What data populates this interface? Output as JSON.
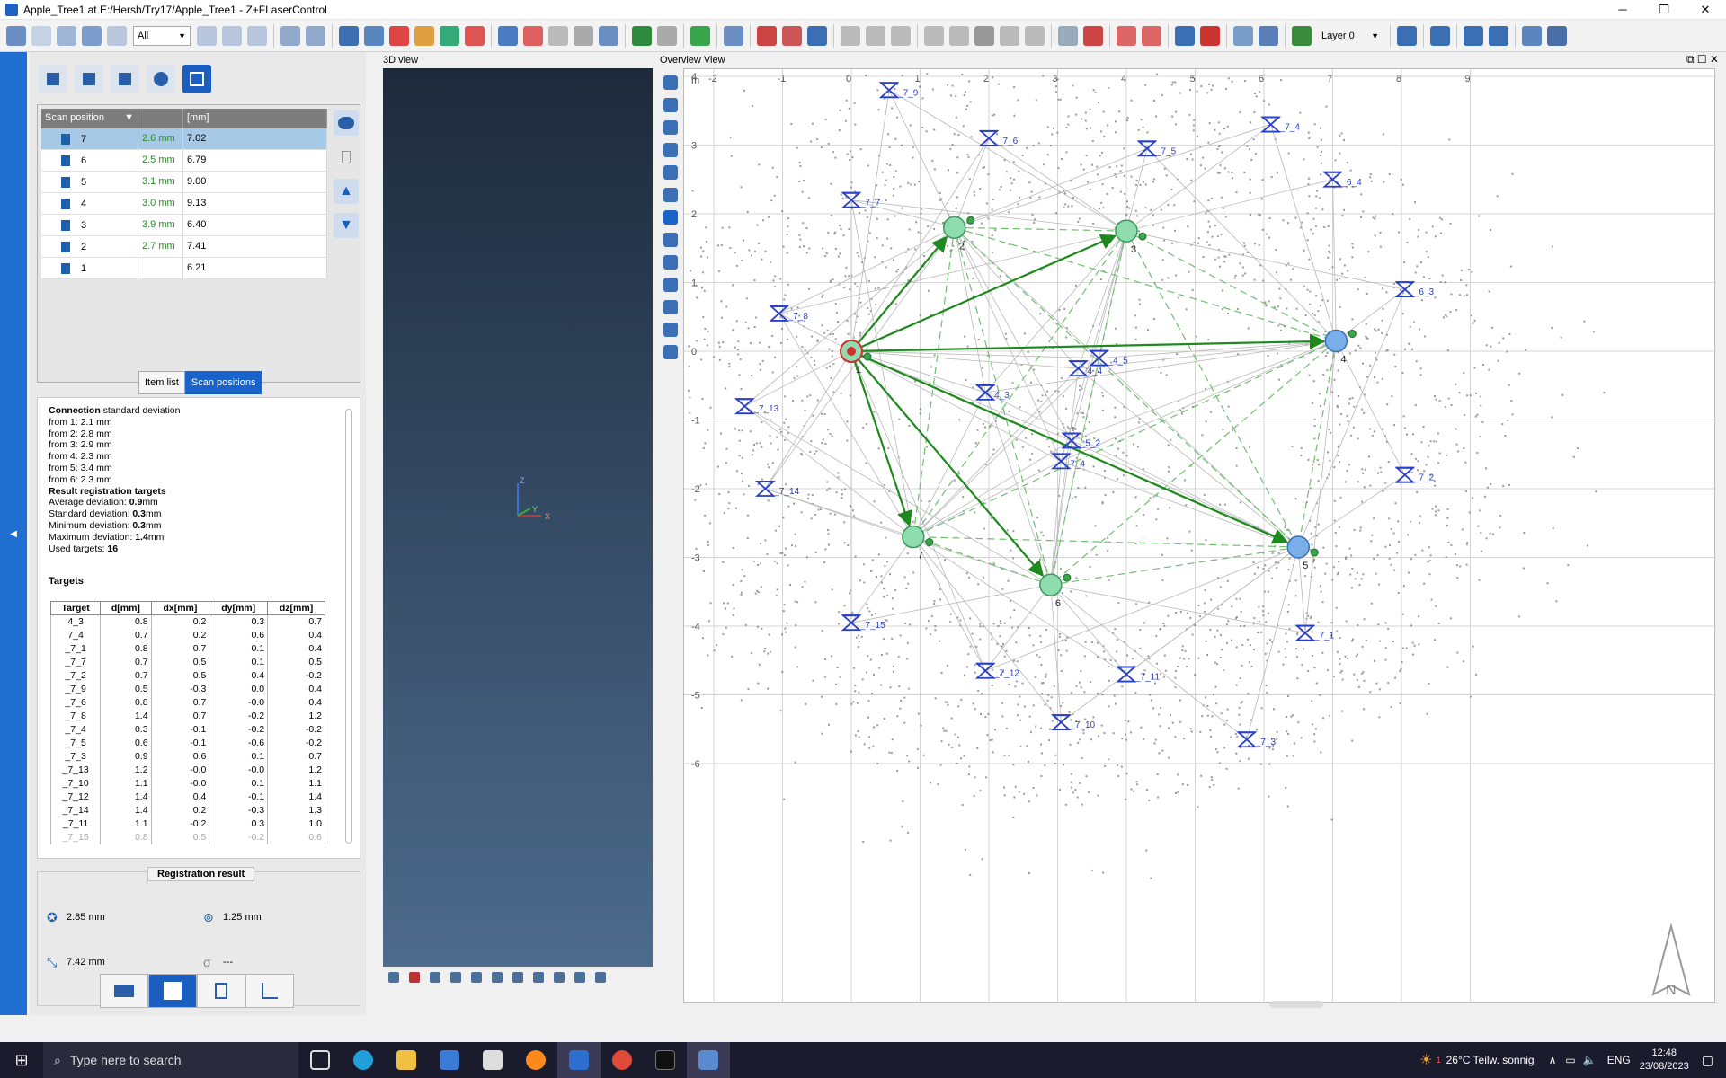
{
  "window": {
    "title": "Apple_Tree1 at E:/Hersh/Try17/Apple_Tree1 - Z+FLaserControl",
    "min": "─",
    "max": "❐",
    "close": "✕"
  },
  "toolbar": {
    "filter_value": "All",
    "layer_value": "Layer 0"
  },
  "scan_table": {
    "headers": [
      "Scan position",
      "",
      "[mm]"
    ],
    "rows": [
      {
        "id": "7",
        "dev": "2.6 mm",
        "val": "7.02"
      },
      {
        "id": "6",
        "dev": "2.5 mm",
        "val": "6.79"
      },
      {
        "id": "5",
        "dev": "3.1 mm",
        "val": "9.00"
      },
      {
        "id": "4",
        "dev": "3.0 mm",
        "val": "9.13"
      },
      {
        "id": "3",
        "dev": "3.9 mm",
        "val": "6.40"
      },
      {
        "id": "2",
        "dev": "2.7 mm",
        "val": "7.41"
      },
      {
        "id": "1",
        "dev": "",
        "val": "6.21"
      }
    ]
  },
  "tabs": {
    "item_list": "Item list",
    "scan_positions": "Scan positions"
  },
  "info": {
    "connection_label": "Connection",
    "connection_rest": " standard deviation",
    "from_lines": [
      "from 1: 2.1 mm",
      "from 2: 2.8 mm",
      "from 3: 2.9 mm",
      "from 4: 2.3 mm",
      "from 5: 3.4 mm",
      "from 6: 2.3 mm"
    ],
    "result_title": "Result registration targets",
    "avg_label": "Average deviation: ",
    "avg_val": "0.9",
    "unit": "mm",
    "std_label": "Standard deviation: ",
    "std_val": "0.3",
    "min_label": "Minimum deviation: ",
    "min_val": "0.3",
    "max_label": "Maximum deviation: ",
    "max_val": "1.4",
    "used_label": "Used targets: ",
    "used_val": "16"
  },
  "targets": {
    "title": "Targets",
    "headers": [
      "Target",
      "d[mm]",
      "dx[mm]",
      "dy[mm]",
      "dz[mm]"
    ],
    "rows": [
      [
        "4_3",
        "0.8",
        "0.2",
        "0.3",
        "0.7"
      ],
      [
        "7_4",
        "0.7",
        "0.2",
        "0.6",
        "0.4"
      ],
      [
        "_7_1",
        "0.8",
        "0.7",
        "0.1",
        "0.4"
      ],
      [
        "_7_7",
        "0.7",
        "0.5",
        "0.1",
        "0.5"
      ],
      [
        "_7_2",
        "0.7",
        "0.5",
        "0.4",
        "-0.2"
      ],
      [
        "_7_9",
        "0.5",
        "-0.3",
        "0.0",
        "0.4"
      ],
      [
        "_7_6",
        "0.8",
        "0.7",
        "-0.0",
        "0.4"
      ],
      [
        "_7_8",
        "1.4",
        "0.7",
        "-0.2",
        "1.2"
      ],
      [
        "_7_4",
        "0.3",
        "-0.1",
        "-0.2",
        "-0.2"
      ],
      [
        "_7_5",
        "0.6",
        "-0.1",
        "-0.6",
        "-0.2"
      ],
      [
        "_7_3",
        "0.9",
        "0.6",
        "0.1",
        "0.7"
      ],
      [
        "_7_13",
        "1.2",
        "-0.0",
        "-0.0",
        "1.2"
      ],
      [
        "_7_10",
        "1.1",
        "-0.0",
        "0.1",
        "1.1"
      ],
      [
        "_7_12",
        "1.4",
        "0.4",
        "-0.1",
        "1.4"
      ],
      [
        "_7_14",
        "1.4",
        "0.2",
        "-0.3",
        "1.3"
      ],
      [
        "_7_11",
        "1.1",
        "-0.2",
        "0.3",
        "1.0"
      ],
      [
        "_7_15",
        "0.8",
        "0.5",
        "-0.2",
        "0.6"
      ]
    ]
  },
  "registration": {
    "title": "Registration result",
    "v1": "2.85 mm",
    "v2": "1.25 mm",
    "v3": "7.42 mm",
    "v4": "---"
  },
  "view3d": {
    "title": "3D view",
    "axis_z": "Z",
    "axis_y": "Y",
    "axis_x": "X"
  },
  "overview": {
    "title": "Overview View",
    "unit": "m",
    "xticks": [
      "-2",
      "-1",
      "0",
      "1",
      "2",
      "3",
      "4",
      "5",
      "6",
      "7",
      "8",
      "9"
    ],
    "yticks": [
      "4",
      "3",
      "2",
      "1",
      "0",
      "-1",
      "-2",
      "-3",
      "-4",
      "-5",
      "-6"
    ],
    "north": "N",
    "scans": [
      {
        "id": "1",
        "x": 0.0,
        "y": 0.0,
        "kind": "ref"
      },
      {
        "id": "2",
        "x": 1.5,
        "y": 1.8,
        "kind": "green"
      },
      {
        "id": "3",
        "x": 4.0,
        "y": 1.75,
        "kind": "green"
      },
      {
        "id": "4",
        "x": 7.05,
        "y": 0.15,
        "kind": "blue"
      },
      {
        "id": "5",
        "x": 6.5,
        "y": -2.85,
        "kind": "blue"
      },
      {
        "id": "6",
        "x": 2.9,
        "y": -3.4,
        "kind": "green"
      },
      {
        "id": "7",
        "x": 0.9,
        "y": -2.7,
        "kind": "green"
      }
    ],
    "targets": [
      {
        "label": "_7_9",
        "x": 0.55,
        "y": 3.8
      },
      {
        "label": "_7_6",
        "x": 2.0,
        "y": 3.1
      },
      {
        "label": "_7_5",
        "x": 4.3,
        "y": 2.95
      },
      {
        "label": "_7_4",
        "x": 6.1,
        "y": 3.3
      },
      {
        "label": "_6_4",
        "x": 7.0,
        "y": 2.5
      },
      {
        "label": "_7_7",
        "x": 0.0,
        "y": 2.2
      },
      {
        "label": "_7_8",
        "x": -1.05,
        "y": 0.55
      },
      {
        "label": "_6_3",
        "x": 8.05,
        "y": 0.9
      },
      {
        "label": "_7_13",
        "x": -1.55,
        "y": -0.8
      },
      {
        "label": "4_3",
        "x": 1.95,
        "y": -0.6
      },
      {
        "label": "4_4",
        "x": 3.3,
        "y": -0.25
      },
      {
        "label": "_4_5",
        "x": 3.6,
        "y": -0.1
      },
      {
        "label": "_5_2",
        "x": 3.2,
        "y": -1.3
      },
      {
        "label": "7_4",
        "x": 3.05,
        "y": -1.6
      },
      {
        "label": "_7_2",
        "x": 8.05,
        "y": -1.8
      },
      {
        "label": "_7_14",
        "x": -1.25,
        "y": -2.0
      },
      {
        "label": "_7_15",
        "x": 0.0,
        "y": -3.95
      },
      {
        "label": "_7_1",
        "x": 6.6,
        "y": -4.1
      },
      {
        "label": "_7_12",
        "x": 1.95,
        "y": -4.65
      },
      {
        "label": "_7_11",
        "x": 4.0,
        "y": -4.7
      },
      {
        "label": "_7_10",
        "x": 3.05,
        "y": -5.4
      },
      {
        "label": "_7_3",
        "x": 5.75,
        "y": -5.65
      }
    ]
  },
  "taskbar": {
    "search_placeholder": "Type here to search",
    "weather": "26°C  Teilw. sonnig",
    "lang": "ENG",
    "time": "12:48",
    "date": "23/08/2023",
    "notif": "1"
  }
}
